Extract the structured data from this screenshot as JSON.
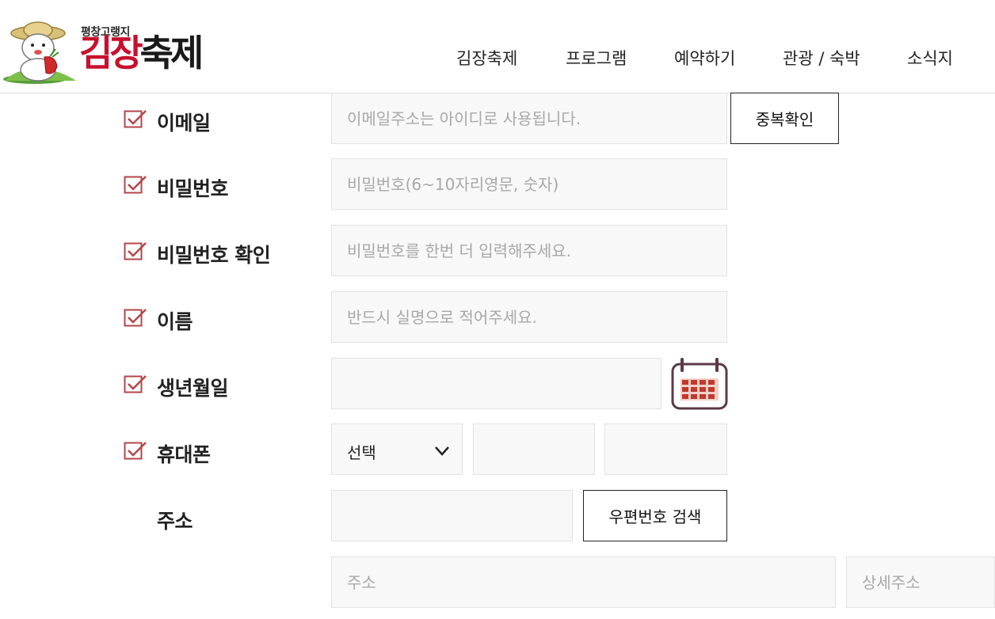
{
  "brand": {
    "sub": "평창고랭지",
    "main_part1": "김장",
    "main_part2": "축제"
  },
  "nav": {
    "items": [
      {
        "label": "김장축제"
      },
      {
        "label": "프로그램"
      },
      {
        "label": "예약하기"
      },
      {
        "label": "관광 / 숙박"
      },
      {
        "label": "소식지"
      }
    ]
  },
  "form": {
    "email": {
      "label": "이메일",
      "placeholder": "이메일주소는 아이디로 사용됩니다.",
      "button": "중복확인"
    },
    "password": {
      "label": "비밀번호",
      "placeholder": "비밀번호(6~10자리영문, 숫자)"
    },
    "password_confirm": {
      "label": "비밀번호 확인",
      "placeholder": "비밀번호를 한번 더 입력해주세요."
    },
    "name": {
      "label": "이름",
      "placeholder": "반드시 실명으로 적어주세요."
    },
    "birthdate": {
      "label": "생년월일",
      "placeholder": ""
    },
    "phone": {
      "label": "휴대폰",
      "select_value": "선택"
    },
    "address": {
      "label": "주소",
      "zip_button": "우편번호 검색",
      "address_placeholder": "주소",
      "detail_placeholder": "상세주소"
    }
  },
  "colors": {
    "check_accent": "#b5454a",
    "calendar_accent": "#c0392b"
  }
}
